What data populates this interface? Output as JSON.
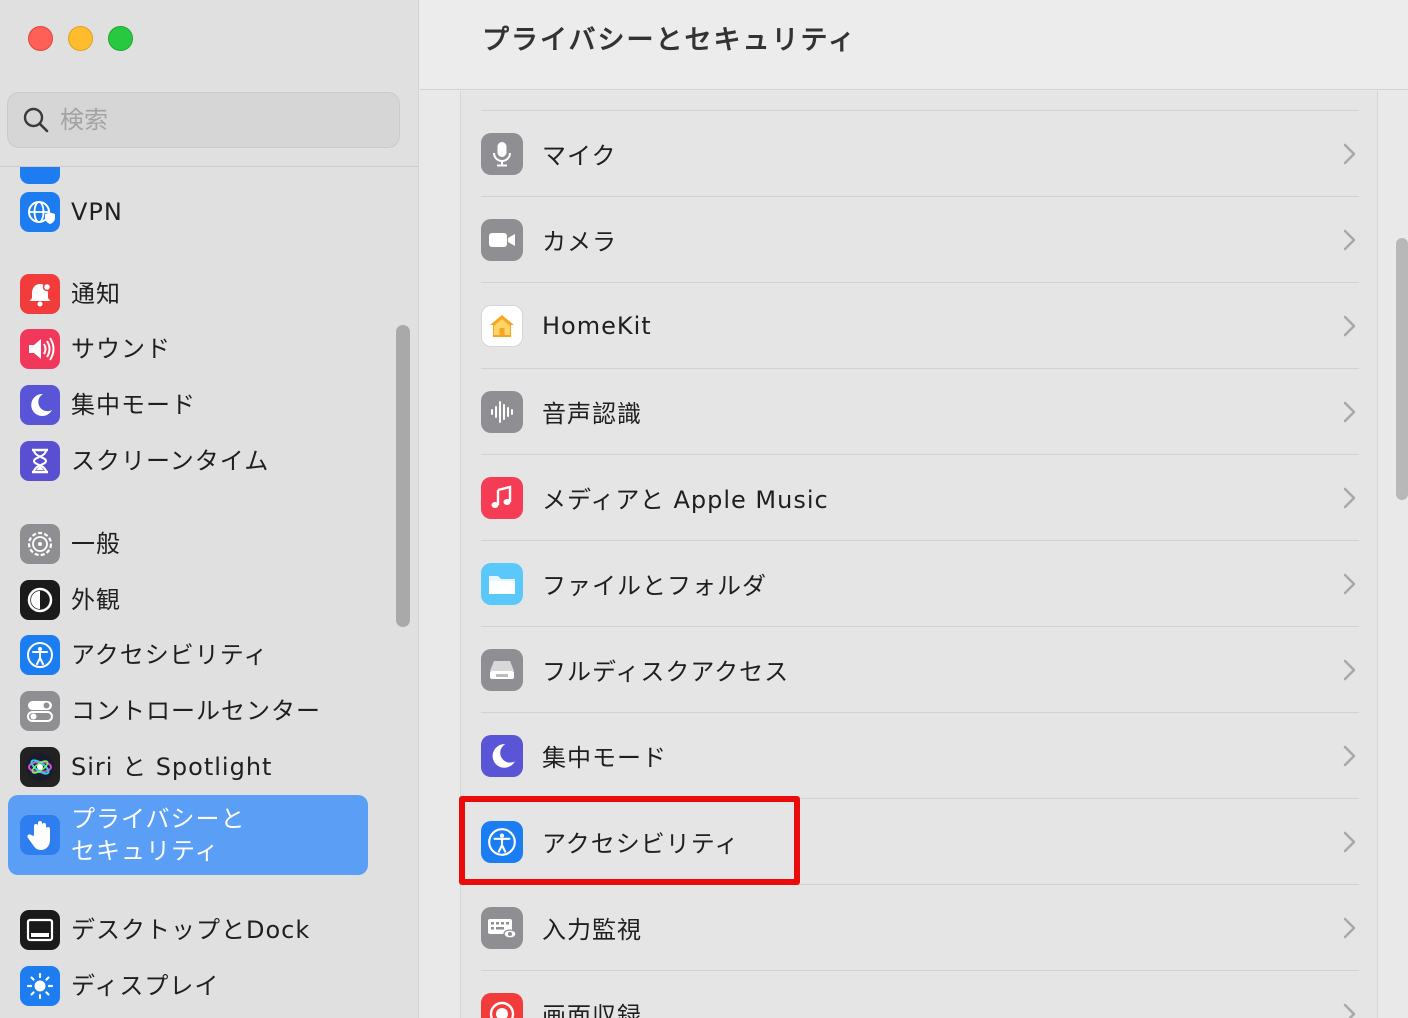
{
  "window": {
    "title": "プライバシーとセキュリティ"
  },
  "search": {
    "placeholder": "検索"
  },
  "sidebar": {
    "items": [
      {
        "label": "VPN",
        "icon": "globe-shield-icon",
        "color": "#1c7cf0"
      },
      {
        "label": "通知",
        "icon": "bell-icon",
        "color": "#f23b3b"
      },
      {
        "label": "サウンド",
        "icon": "speaker-icon",
        "color": "#f2385a"
      },
      {
        "label": "集中モード",
        "icon": "moon-icon",
        "color": "#5a55d6"
      },
      {
        "label": "スクリーンタイム",
        "icon": "hourglass-icon",
        "color": "#5a4fd1"
      },
      {
        "label": "一般",
        "icon": "gear-icon",
        "color": "#8e8e93"
      },
      {
        "label": "外観",
        "icon": "appearance-icon",
        "color": "#1a1a1a"
      },
      {
        "label": "アクセシビリティ",
        "icon": "accessibility-icon",
        "color": "#1a7ef2"
      },
      {
        "label": "コントロールセンター",
        "icon": "toggles-icon",
        "color": "#8e8e93"
      },
      {
        "label": "Siri と Spotlight",
        "icon": "siri-icon",
        "color": "#222222"
      },
      {
        "label": "プライバシーと\nセキュリティ",
        "icon": "hand-icon",
        "color": "#2f7ef0",
        "selected": true
      },
      {
        "label": "デスクトップとDock",
        "icon": "dock-icon",
        "color": "#1a1a1a"
      },
      {
        "label": "ディスプレイ",
        "icon": "sun-icon",
        "color": "#1c7cf0"
      }
    ]
  },
  "main": {
    "rows": [
      {
        "label": "マイク",
        "icon": "microphone-icon",
        "color": "#8e8e93"
      },
      {
        "label": "カメラ",
        "icon": "camera-icon",
        "color": "#8e8e93"
      },
      {
        "label": "HomeKit",
        "icon": "home-icon",
        "color": "#f5a623"
      },
      {
        "label": "音声認識",
        "icon": "waveform-icon",
        "color": "#8e8e93"
      },
      {
        "label": "メディアと Apple Music",
        "icon": "music-note-icon",
        "color": "#f43d55"
      },
      {
        "label": "ファイルとフォルダ",
        "icon": "folder-icon",
        "color": "#5ac8fa"
      },
      {
        "label": "フルディスクアクセス",
        "icon": "disk-icon",
        "color": "#8e8e93"
      },
      {
        "label": "集中モード",
        "icon": "moon-icon",
        "color": "#5a55d6"
      },
      {
        "label": "アクセシビリティ",
        "icon": "accessibility-icon",
        "color": "#1a7ef2",
        "highlighted": true
      },
      {
        "label": "入力監視",
        "icon": "keyboard-eye-icon",
        "color": "#8e8e93"
      },
      {
        "label": "画面収録",
        "icon": "record-icon",
        "color": "#f23b3b"
      }
    ]
  },
  "highlight_color": "#ea0c0c"
}
